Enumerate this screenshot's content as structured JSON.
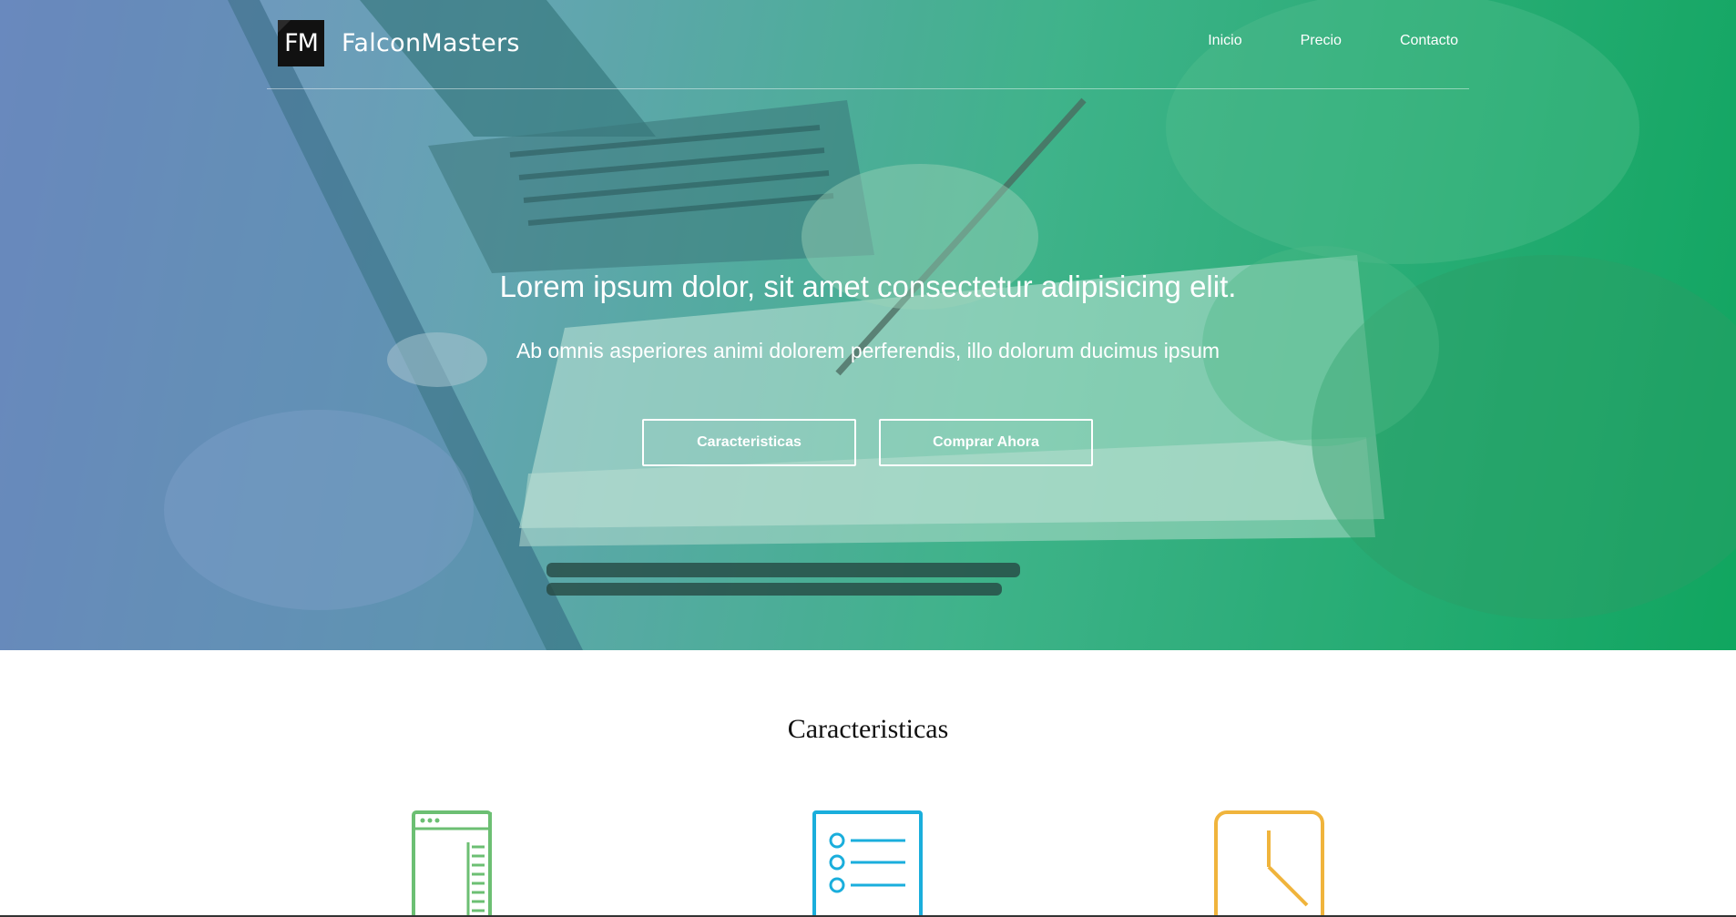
{
  "brand": {
    "mark": "FM",
    "name": "FalconMasters"
  },
  "nav": {
    "items": [
      "Inicio",
      "Precio",
      "Contacto"
    ]
  },
  "hero": {
    "title": "Lorem ipsum dolor, sit amet consectetur adipisicing elit.",
    "subtitle": "Ab omnis asperiores animi dolorem perferendis, illo dolorum ducimus ipsum",
    "buttons": {
      "primary": "Caracteristicas",
      "secondary": "Comprar Ahora"
    },
    "gradient_colors": [
      "#7f8ccf",
      "#3fb48a",
      "#0aa55a"
    ]
  },
  "features": {
    "title": "Caracteristicas",
    "icons": [
      {
        "name": "browser-layout-icon",
        "color": "#6cbf73"
      },
      {
        "name": "checklist-icon",
        "color": "#1aaedc"
      },
      {
        "name": "clock-icon",
        "color": "#f0b43c"
      }
    ]
  }
}
